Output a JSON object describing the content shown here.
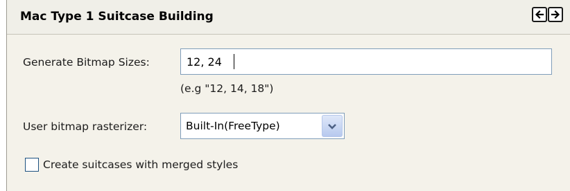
{
  "header": {
    "title": "Mac Type 1 Suitcase Building",
    "back_icon": "arrow-left-icon",
    "forward_icon": "arrow-right-icon"
  },
  "bitmap_sizes": {
    "label": "Generate Bitmap Sizes:",
    "value": "12, 24",
    "hint": "(e.g \"12, 14, 18\")"
  },
  "rasterizer": {
    "label": "User bitmap rasterizer:",
    "selected": "Built-In(FreeType)",
    "arrow_icon": "chevron-down-icon"
  },
  "merged_styles": {
    "label": "Create suitcases with merged styles",
    "checked": false
  },
  "colors": {
    "panel_bg": "#f4f2ea",
    "input_border": "#7f9db9",
    "dropdown_button": "#b7c9ee",
    "arrow_color": "#4d6185"
  }
}
